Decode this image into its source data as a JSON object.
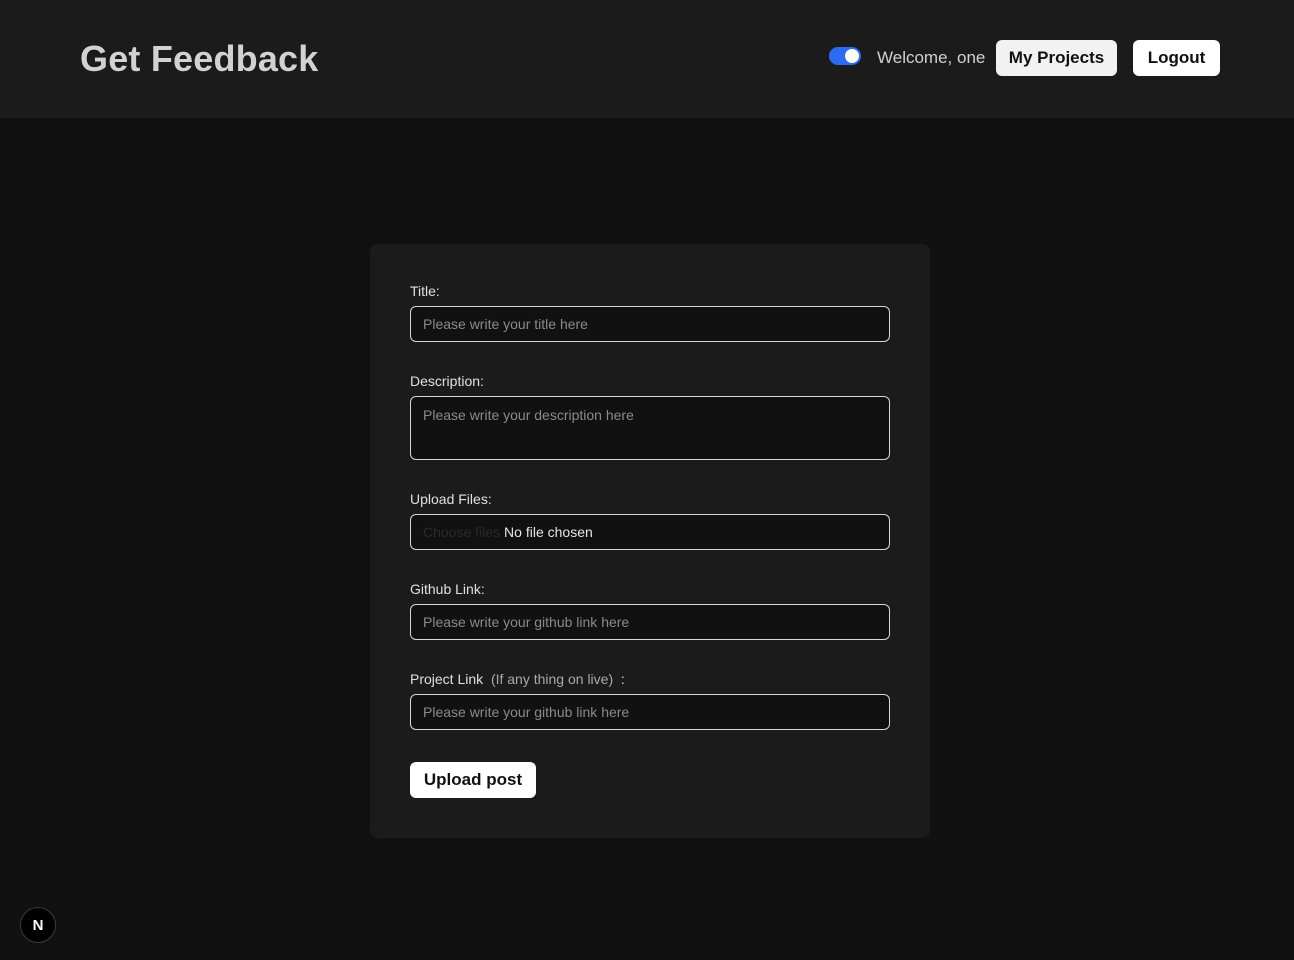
{
  "header": {
    "brand": "Get Feedback",
    "theme_toggle_on": true,
    "welcome": "Welcome, one",
    "my_projects_label": "My Projects",
    "logout_label": "Logout"
  },
  "form": {
    "title_label": "Title:",
    "title_placeholder": "Please write your title here",
    "description_label": "Description:",
    "description_placeholder": "Please write your description here",
    "upload_label": "Upload Files:",
    "choose_files_label": "Choose files",
    "file_status": "No file chosen",
    "github_label": "Github Link:",
    "github_placeholder": "Please write your github link here",
    "project_label": "Project Link",
    "project_hint": "(If any thing on live)",
    "project_colon": ":",
    "project_placeholder": "Please write your github link here",
    "submit_label": "Upload post"
  },
  "badge": {
    "letter": "N"
  },
  "colors": {
    "accent": "#2d6bf3",
    "background": "#111111",
    "card": "#1b1b1b"
  }
}
